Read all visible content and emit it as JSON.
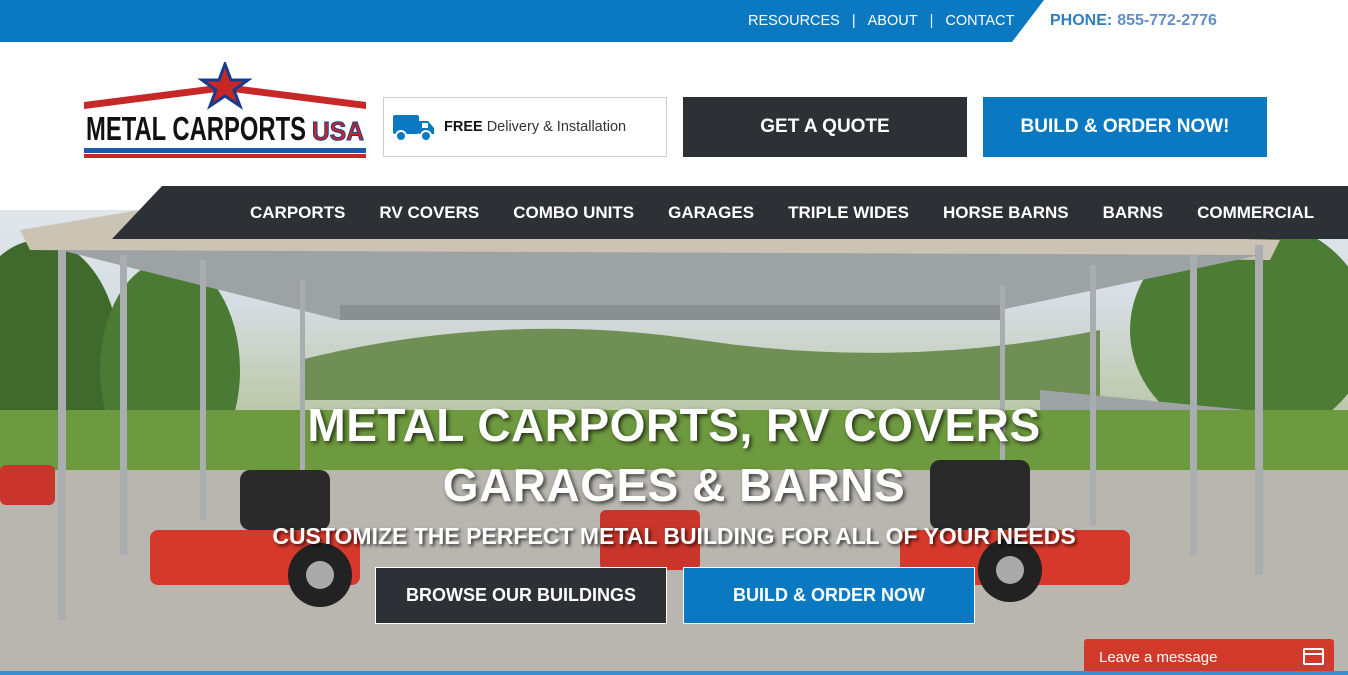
{
  "topbar": {
    "links": [
      "RESOURCES",
      "ABOUT",
      "CONTACT"
    ],
    "separator": "|",
    "phone_label": "PHONE:",
    "phone_number": "855-772-2776"
  },
  "logo": {
    "line1": "METAL CARPORTS",
    "line2": "USA"
  },
  "delivery": {
    "bold": "FREE",
    "text": " Delivery & Installation"
  },
  "header_buttons": {
    "quote": "GET A QUOTE",
    "build": "BUILD & ORDER NOW!"
  },
  "nav": {
    "items": [
      "CARPORTS",
      "RV COVERS",
      "COMBO UNITS",
      "GARAGES",
      "TRIPLE WIDES",
      "HORSE BARNS",
      "BARNS",
      "COMMERCIAL"
    ]
  },
  "hero": {
    "title_line1": "METAL CARPORTS, RV COVERS",
    "title_line2": "GARAGES & BARNS",
    "subtitle": "CUSTOMIZE THE PERFECT METAL BUILDING FOR ALL OF YOUR NEEDS",
    "browse_button": "BROWSE OUR BUILDINGS",
    "order_button": "BUILD & ORDER NOW"
  },
  "chat": {
    "label": "Leave a message"
  },
  "colors": {
    "brand_blue": "#0a79c2",
    "dark": "#2d3035",
    "chat_red": "#d13a2a"
  }
}
